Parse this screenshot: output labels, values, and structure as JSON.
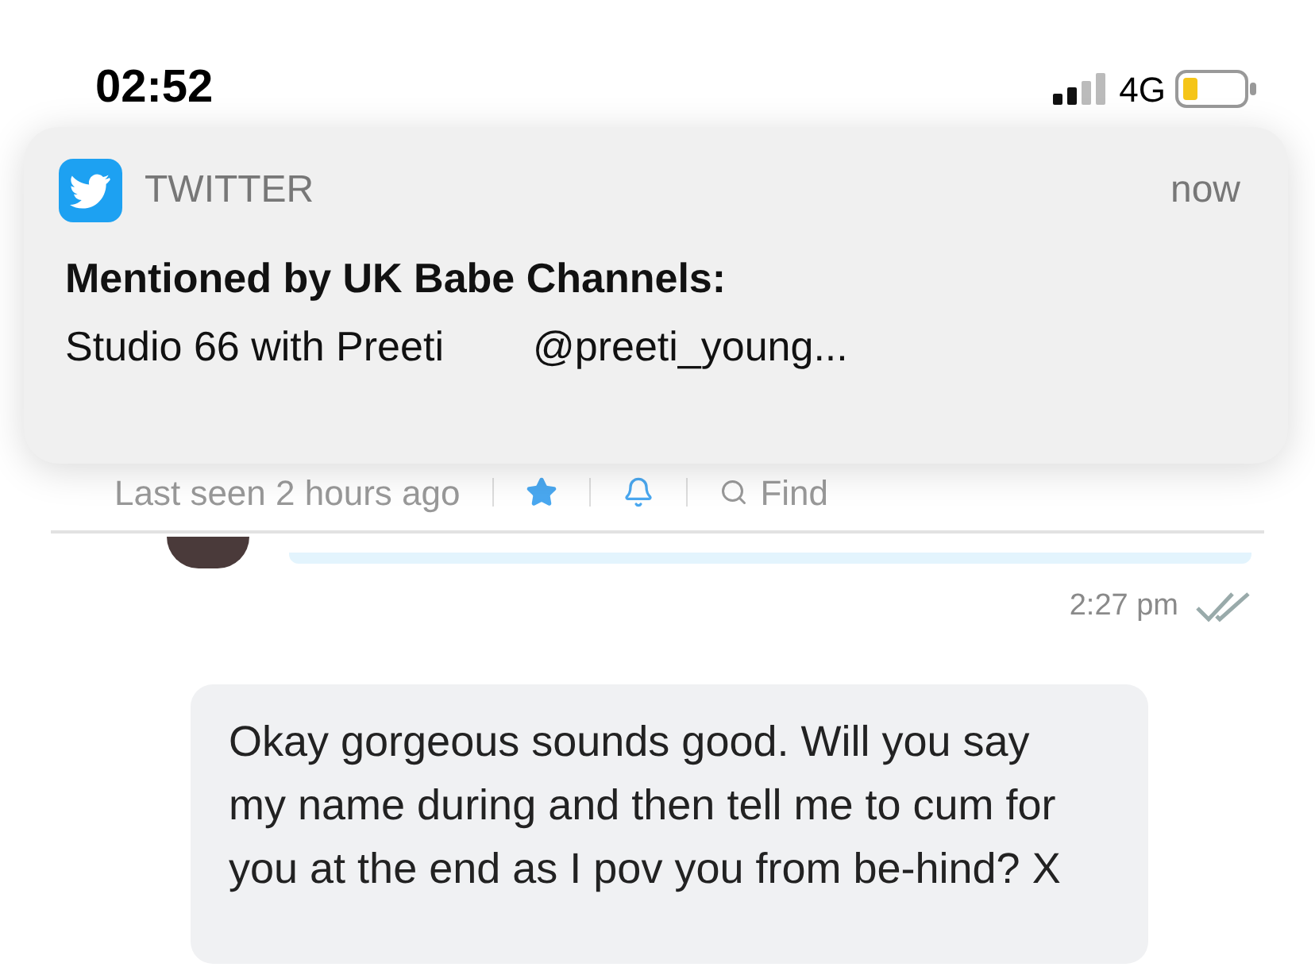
{
  "status_bar": {
    "time": "02:52",
    "network": "4G"
  },
  "notification": {
    "app": "TWITTER",
    "time": "now",
    "title": "Mentioned by UK Babe Channels:",
    "body": "Studio 66 with Preeti",
    "handle": "@preeti_young..."
  },
  "chat_header": {
    "last_seen": "Last seen 2 hours ago",
    "find": "Find"
  },
  "messages": [
    {
      "kind": "time",
      "time": "2:27 pm"
    },
    {
      "kind": "bubble",
      "text": "Okay gorgeous sounds good. Will you say my name during and then tell me to cum for you at the end as I pov you from be-hind? X"
    }
  ]
}
